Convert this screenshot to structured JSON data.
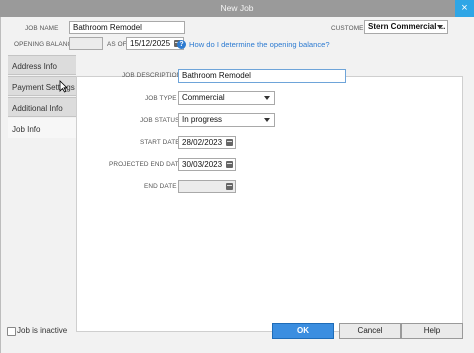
{
  "window": {
    "title": "New Job",
    "close_label": "×"
  },
  "header": {
    "job_name_label": "JOB NAME",
    "job_name_value": "Bathroom Remodel",
    "customer_label": "CUSTOMER",
    "customer_value": "Stern Commercial ...",
    "opening_balance_label": "OPENING BALANCE",
    "opening_balance_value": "",
    "as_of_label": "AS OF",
    "as_of_value": "15/12/2025",
    "help_link": "How do I determine the opening balance?"
  },
  "tabs": [
    {
      "label": "Address Info",
      "active": false
    },
    {
      "label": "Payment Settings",
      "active": false
    },
    {
      "label": "Additional Info",
      "active": false
    },
    {
      "label": "Job Info",
      "active": true
    }
  ],
  "job_info": {
    "description_label": "JOB DESCRIPTION",
    "description_value": "Bathroom Remodel",
    "type_label": "JOB TYPE",
    "type_value": "Commercial",
    "status_label": "JOB STATUS",
    "status_value": "In progress",
    "start_label": "START DATE",
    "start_value": "28/02/2023",
    "projected_end_label": "PROJECTED END DATE",
    "projected_end_value": "30/03/2023",
    "end_label": "END DATE",
    "end_value": ""
  },
  "footer": {
    "inactive_label": "Job is inactive",
    "inactive_checked": false,
    "ok_label": "OK",
    "cancel_label": "Cancel",
    "help_label": "Help"
  },
  "colors": {
    "primary_button": "#3b8ee0",
    "link": "#2d7bd1",
    "close_button": "#2fa6e6"
  }
}
